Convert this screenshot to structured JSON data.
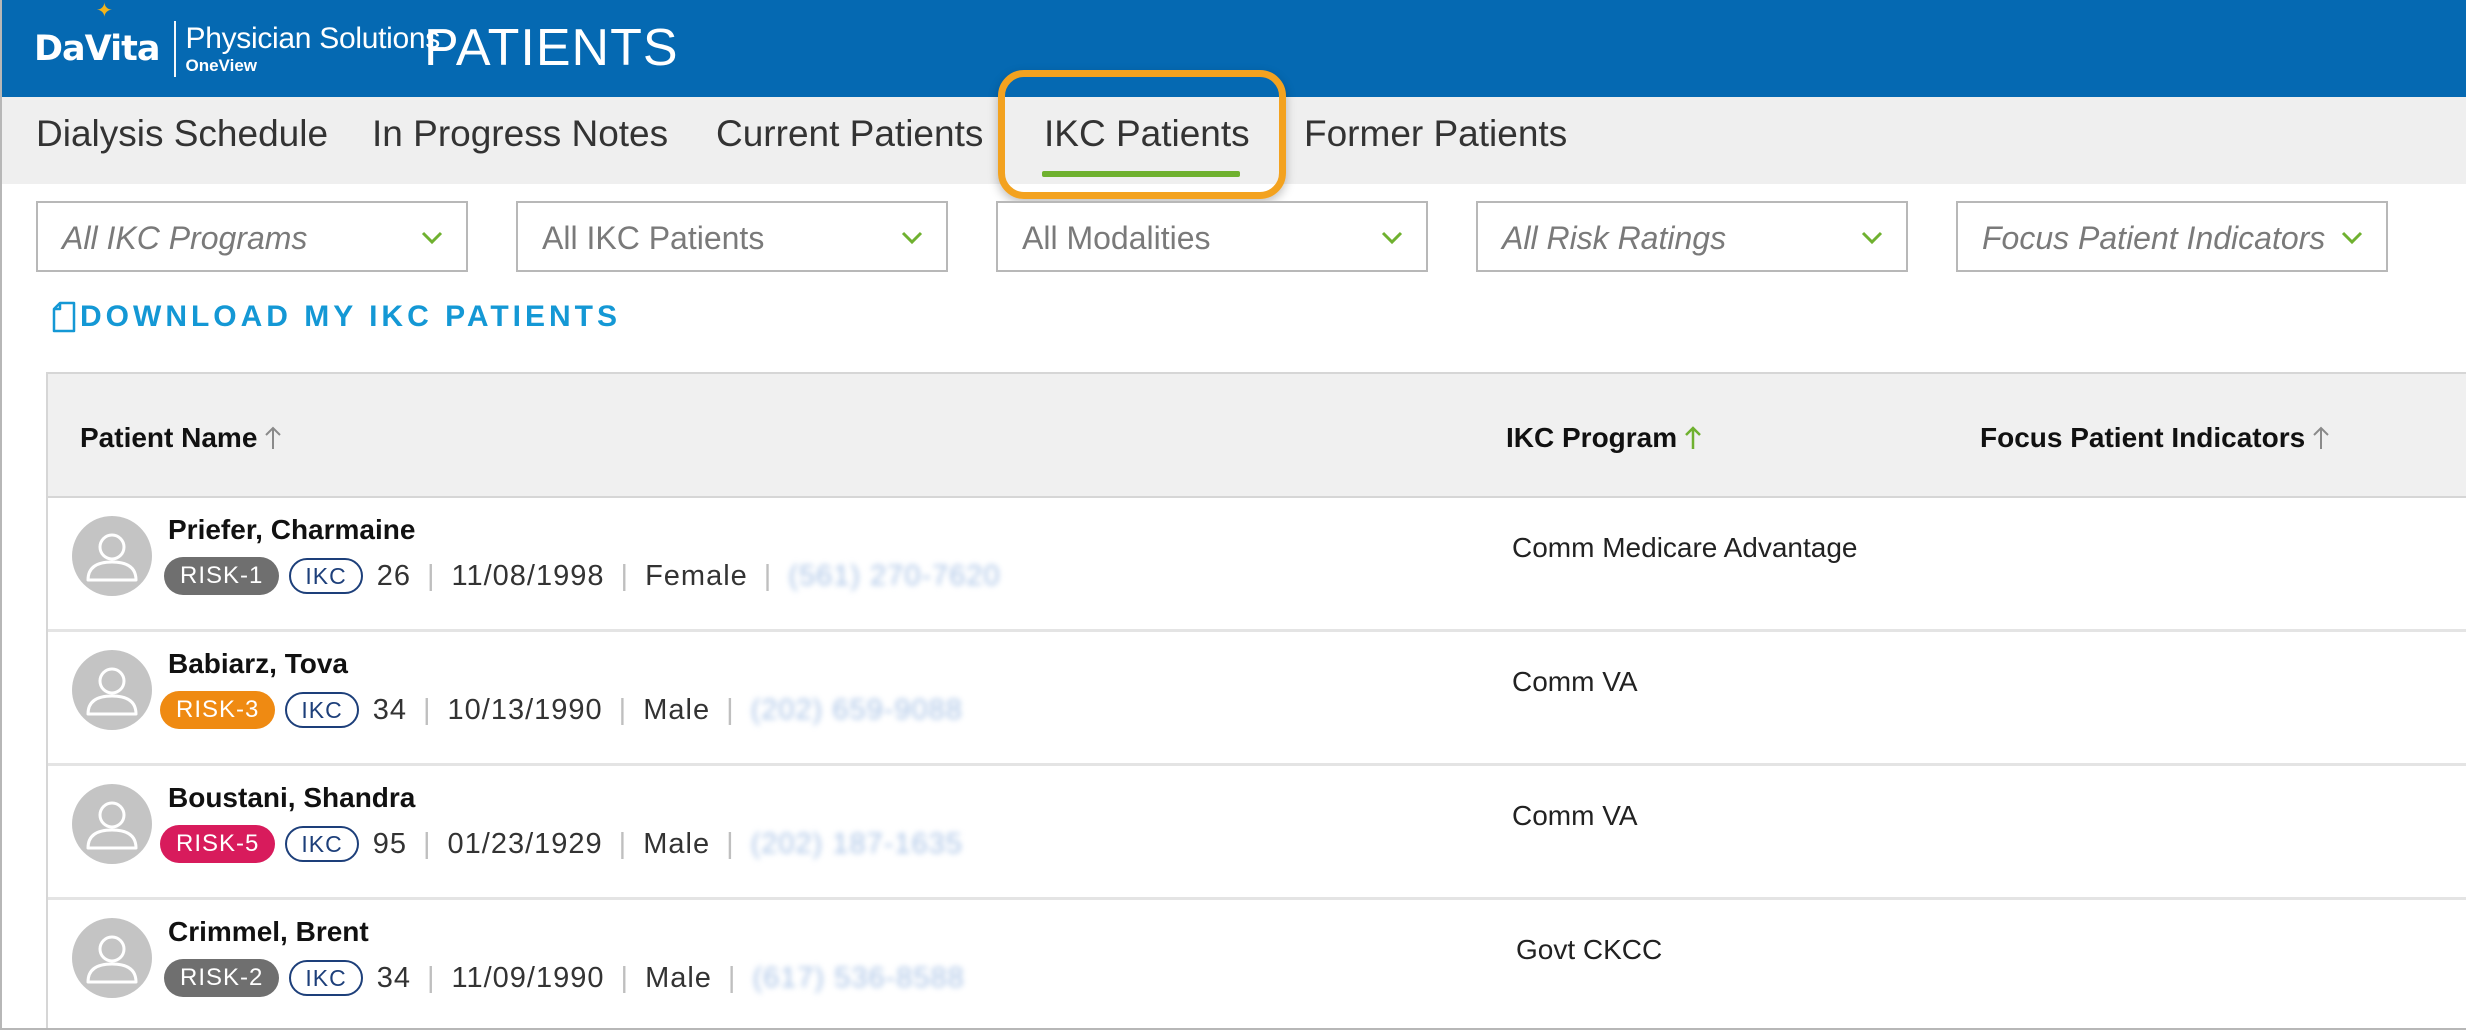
{
  "header": {
    "brand": "DaVita",
    "product": "Physician Solutions",
    "sub": "OneView",
    "title": "PATIENTS",
    "colors": {
      "bar": "#0569b2",
      "star": "#f3b41b"
    }
  },
  "tabs": [
    {
      "label": "Dialysis Schedule"
    },
    {
      "label": "In Progress Notes"
    },
    {
      "label": "Current Patients"
    },
    {
      "label": "IKC Patients",
      "active": true
    },
    {
      "label": "Former Patients"
    }
  ],
  "filters": [
    {
      "label": "All IKC Programs",
      "italic": true
    },
    {
      "label": "All IKC Patients"
    },
    {
      "label": "All Modalities"
    },
    {
      "label": "All Risk Ratings",
      "italic": true
    },
    {
      "label": "Focus Patient Indicators",
      "italic": true
    }
  ],
  "download": {
    "label": "DOWNLOAD MY IKC PATIENTS",
    "icon": "document-icon"
  },
  "table": {
    "columns": [
      {
        "label": "Patient Name",
        "sort_icon": "arrow-up-icon"
      },
      {
        "label": "IKC Program",
        "sort_icon": "arrow-up-icon",
        "sort_active": true
      },
      {
        "label": "Focus Patient Indicators",
        "sort_icon": "arrow-up-icon"
      }
    ],
    "rows": [
      {
        "name": "Priefer, Charmaine",
        "risk": "RISK-1",
        "risk_color": "#6f6f6f",
        "tag": "IKC",
        "age": "26",
        "dob": "11/08/1998",
        "gender": "Female",
        "phone": "(561) 270-7620",
        "program": "Comm Medicare Advantage"
      },
      {
        "name": "Babiarz, Tova",
        "risk": "RISK-3",
        "risk_color": "#ef8a12",
        "tag": "IKC",
        "age": "34",
        "dob": "10/13/1990",
        "gender": "Male",
        "phone": "(202) 659-9088",
        "program": "Comm VA"
      },
      {
        "name": "Boustani, Shandra",
        "risk": "RISK-5",
        "risk_color": "#d81b5c",
        "tag": "IKC",
        "age": "95",
        "dob": "01/23/1929",
        "gender": "Male",
        "phone": "(202) 187-1635",
        "program": "Comm VA"
      },
      {
        "name": "Crimmel, Brent",
        "risk": "RISK-2",
        "risk_color": "#6f6f6f",
        "tag": "IKC",
        "age": "34",
        "dob": "11/09/1990",
        "gender": "Male",
        "phone": "(617) 536-8588",
        "program": "Govt CKCC"
      }
    ]
  },
  "colors": {
    "accent_green": "#6fb12f",
    "highlight_orange": "#f3a21f",
    "link_blue": "#1498d5",
    "ikc_navy": "#1d3f7a"
  }
}
